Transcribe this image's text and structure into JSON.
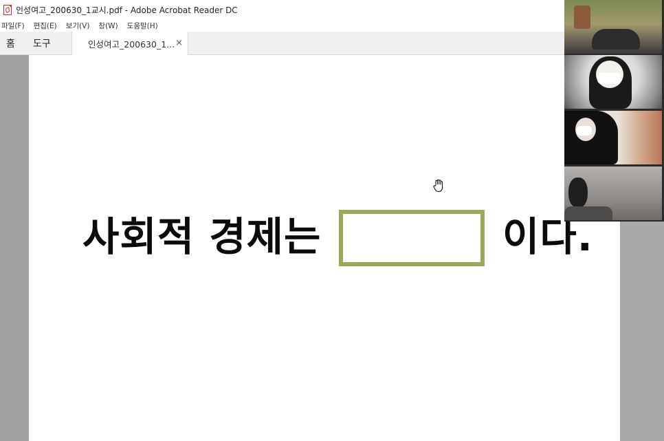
{
  "window": {
    "title": "인성여고_200630_1교시.pdf - Adobe Acrobat Reader DC",
    "icon": "pdf-file-icon"
  },
  "menu": {
    "items": [
      {
        "label": "파일(F)"
      },
      {
        "label": "편집(E)"
      },
      {
        "label": "보기(V)"
      },
      {
        "label": "창(W)"
      },
      {
        "label": "도움말(H)"
      }
    ]
  },
  "tabs": {
    "home": "홈",
    "tools": "도구",
    "document": "인성여고_200630_1...",
    "close_symbol": "×"
  },
  "slide": {
    "text_before": "사회적 경제는",
    "blank_fill": "",
    "text_after": "이다.",
    "blank_border_color": "#9aa858"
  },
  "cursor": {
    "type": "hand-cursor"
  },
  "video_participants": [
    {
      "name": "participant-1"
    },
    {
      "name": "participant-2"
    },
    {
      "name": "participant-3"
    },
    {
      "name": "participant-4"
    }
  ]
}
